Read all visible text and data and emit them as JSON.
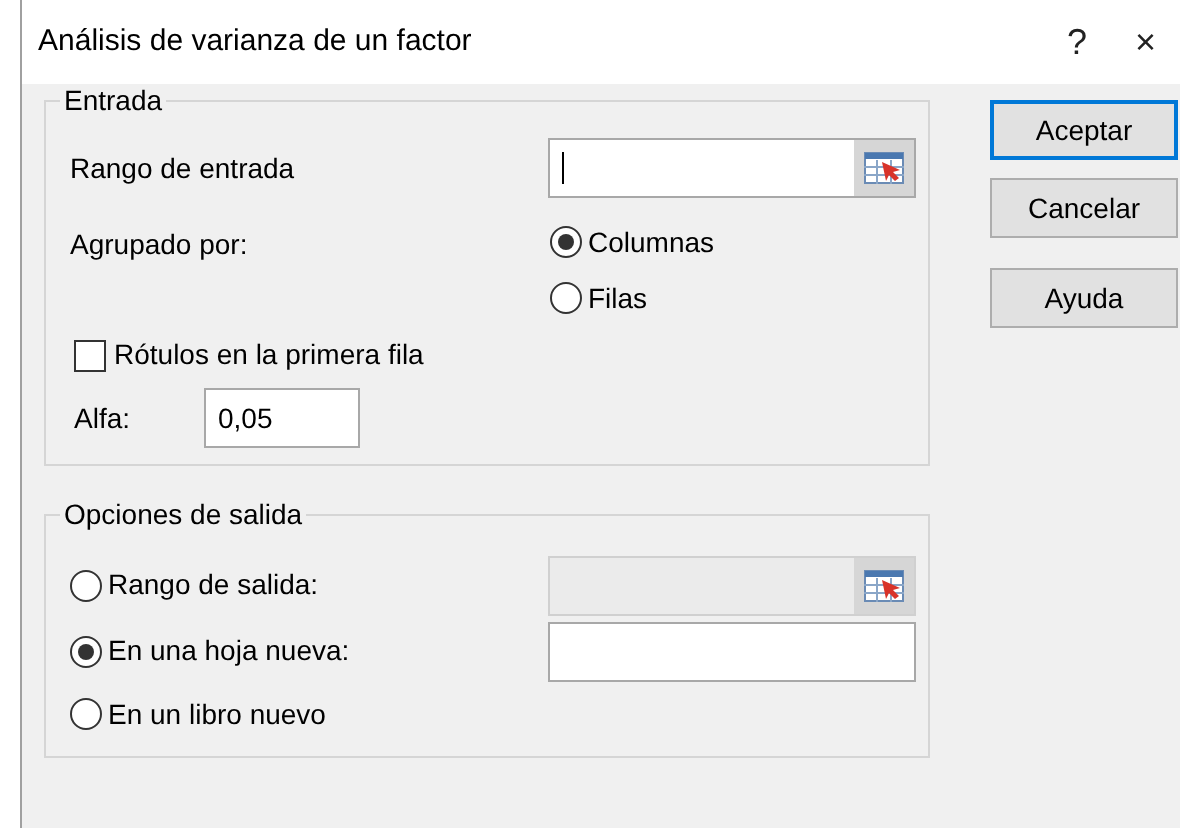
{
  "window": {
    "title": "Análisis de varianza de un factor",
    "help": "?",
    "close": "×"
  },
  "input_group": {
    "legend": "Entrada",
    "range": {
      "label": "Rango de entrada",
      "focused": true
    },
    "grouped_by": {
      "label": "Agrupado por:",
      "options": [
        {
          "label": "Columnas",
          "selected": true
        },
        {
          "label": "Filas",
          "selected": false
        }
      ]
    },
    "labels_first_row": {
      "label": "Rótulos en la primera fila",
      "checked": false
    },
    "alpha": {
      "label": "Alfa:",
      "value": "0,05"
    }
  },
  "output_group": {
    "legend": "Opciones de salida",
    "options": [
      {
        "label": "Rango de salida:",
        "selected": false,
        "field": {
          "disabled": true,
          "picker": true
        }
      },
      {
        "label": "En una hoja nueva:",
        "selected": true,
        "field": {
          "disabled": false,
          "picker": false
        }
      },
      {
        "label": "En un libro nuevo",
        "selected": false
      }
    ]
  },
  "buttons": [
    {
      "label": "Aceptar",
      "default": true
    },
    {
      "label": "Cancelar",
      "default": false
    },
    {
      "label": "Ayuda",
      "default": false
    }
  ]
}
